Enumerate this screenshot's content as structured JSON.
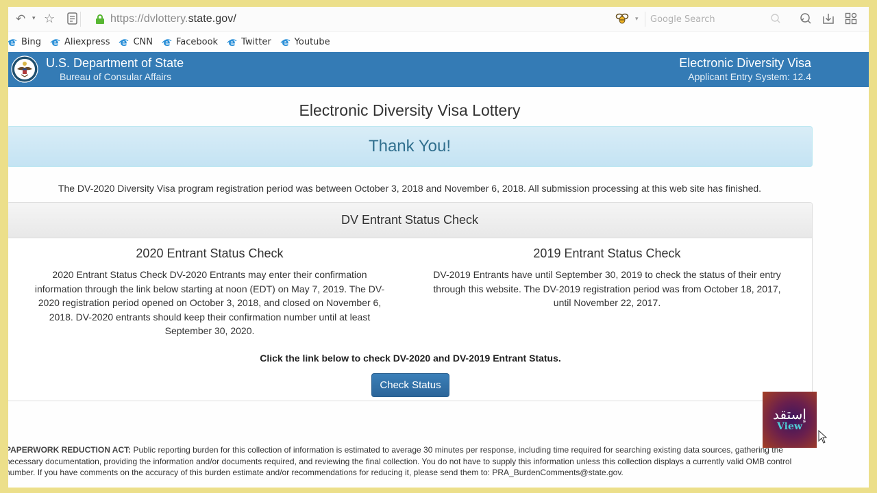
{
  "browser": {
    "url_scheme": "https://dvlottery.",
    "url_host": "state.gov/",
    "search_placeholder": "Google Search",
    "bookmarks": [
      {
        "label": "Bing"
      },
      {
        "label": "Aliexpress"
      },
      {
        "label": "CNN"
      },
      {
        "label": "Facebook"
      },
      {
        "label": "Twitter"
      },
      {
        "label": "Youtube"
      }
    ]
  },
  "site_header": {
    "department": "U.S. Department of State",
    "bureau": "Bureau of Consular Affairs",
    "system_title": "Electronic Diversity Visa",
    "system_version": "Applicant Entry System: 12.4"
  },
  "main": {
    "title": "Electronic Diversity Visa Lottery",
    "thank_you": "Thank You!",
    "registration_note": "The DV-2020 Diversity Visa program registration period was between October 3, 2018 and November 6, 2018. All submission processing at this web site has finished.",
    "status_panel": {
      "heading": "DV Entrant Status Check",
      "col_2020": {
        "title": "2020 Entrant Status Check",
        "text": "2020 Entrant Status Check DV-2020 Entrants may enter their confirmation information through the link below starting at noon (EDT) on May 7, 2019. The DV-2020 registration period opened on October 3, 2018, and closed on November 6, 2018. DV-2020 entrants should keep their confirmation number until at least September 30, 2020."
      },
      "col_2019": {
        "title": "2019 Entrant Status Check",
        "text": "DV-2019 Entrants have until September 30, 2019 to check the status of their entry through this website. The DV-2019 registration period was from October 18, 2017, until November 22, 2017."
      },
      "click_note": "Click the link below to check DV-2020 and DV-2019 Entrant Status.",
      "check_button": "Check Status"
    },
    "paperwork": {
      "label": "PAPERWORK REDUCTION ACT:",
      "text": " Public reporting burden for this collection of information is estimated to average 30 minutes per response, including time required for searching existing data sources, gathering the necessary documentation, providing the information and/or documents required, and reviewing the final collection. You do not have to supply this information unless this collection displays a currently valid OMB control number. If you have comments on the accuracy of this burden estimate and/or recommendations for reducing it, please send them to: PRA_BurdenComments@state.gov."
    }
  },
  "watermark": {
    "arabic": "إستقد",
    "latin": "View"
  },
  "colors": {
    "header_blue": "#347bb5",
    "thanks_text": "#31708f",
    "button_blue": "#2c6599",
    "lock_green": "#58b733",
    "frame_yellow": "#ecdf8a"
  }
}
